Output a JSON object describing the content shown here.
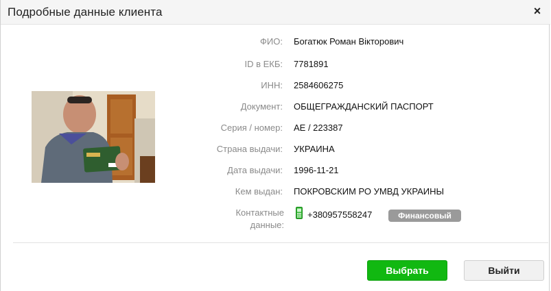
{
  "dialog": {
    "title": "Подробные данные клиента",
    "close_glyph": "×"
  },
  "client": {
    "fields": [
      {
        "label": "ФИО:",
        "value": "Богатюк Роман Вікторович"
      },
      {
        "label": "ID в ЕКБ:",
        "value": "7781891"
      },
      {
        "label": "ИНН:",
        "value": "2584606275"
      },
      {
        "label": "Документ:",
        "value": "ОБЩЕГРАЖДАНСКИЙ ПАСПОРТ"
      },
      {
        "label": "Серия / номер:",
        "value": "АЕ / 223387"
      },
      {
        "label": "Страна выдачи:",
        "value": "УКРАИНА"
      },
      {
        "label": "Дата выдачи:",
        "value": "1996-11-21"
      },
      {
        "label": "Кем выдан:",
        "value": "ПОКРОВСКИМ РО УМВД УКРАИНЫ"
      }
    ],
    "contact": {
      "label_line1": "Контактные",
      "label_line2": "данные:",
      "phone": "+380957558247",
      "phone_icon": "mobile-phone-icon",
      "badge": "Финансовый"
    }
  },
  "footer": {
    "select_label": "Выбрать",
    "exit_label": "Выйти"
  },
  "colors": {
    "accent_green": "#11b811",
    "badge_gray": "#9a9a9a",
    "label_gray": "#8a8a8a"
  }
}
